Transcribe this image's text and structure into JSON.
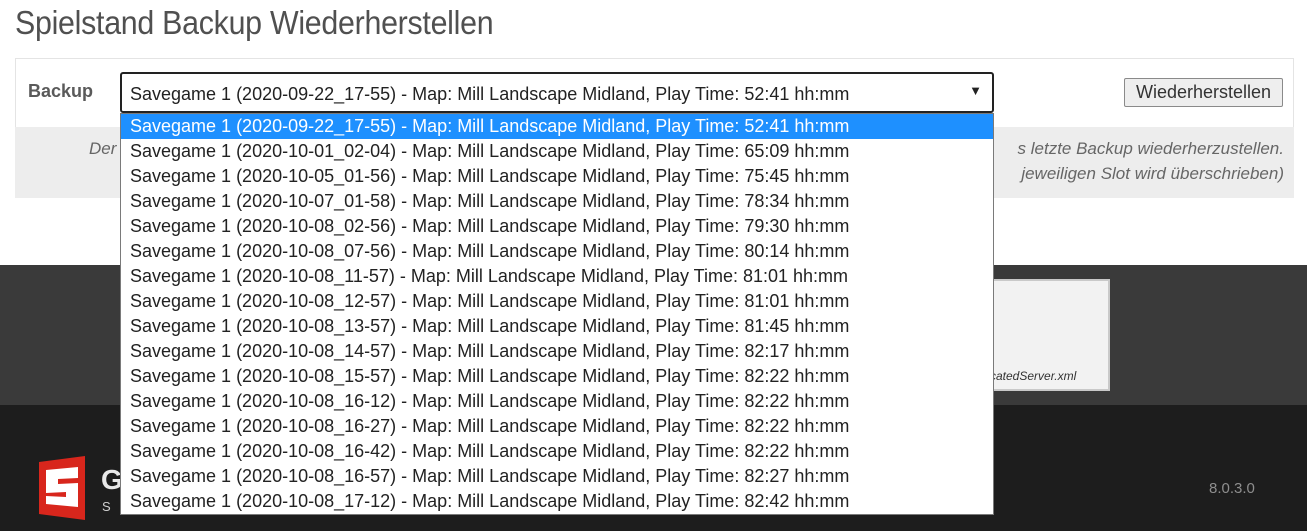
{
  "page": {
    "title": "Spielstand Backup Wiederherstellen"
  },
  "form": {
    "backup_label": "Backup",
    "selected_value": "Savegame 1 (2020-09-22_17-55) - Map: Mill Landscape Midland, Play Time: 52:41 hh:mm",
    "dropdown_arrow": "▼",
    "restore_button": "Wiederherstellen"
  },
  "info": {
    "left_fragment": "Der",
    "right_line1": "s letzte Backup wiederherzustellen.",
    "right_line2": "jeweiligen Slot wird überschrieben)"
  },
  "dropdown": {
    "options": [
      "Savegame 1 (2020-09-22_17-55) - Map: Mill Landscape Midland, Play Time: 52:41 hh:mm",
      "Savegame 1 (2020-10-01_02-04) - Map: Mill Landscape Midland, Play Time: 65:09 hh:mm",
      "Savegame 1 (2020-10-05_01-56) - Map: Mill Landscape Midland, Play Time: 75:45 hh:mm",
      "Savegame 1 (2020-10-07_01-58) - Map: Mill Landscape Midland, Play Time: 78:34 hh:mm",
      "Savegame 1 (2020-10-08_02-56) - Map: Mill Landscape Midland, Play Time: 79:30 hh:mm",
      "Savegame 1 (2020-10-08_07-56) - Map: Mill Landscape Midland, Play Time: 80:14 hh:mm",
      "Savegame 1 (2020-10-08_11-57) - Map: Mill Landscape Midland, Play Time: 81:01 hh:mm",
      "Savegame 1 (2020-10-08_12-57) - Map: Mill Landscape Midland, Play Time: 81:01 hh:mm",
      "Savegame 1 (2020-10-08_13-57) - Map: Mill Landscape Midland, Play Time: 81:45 hh:mm",
      "Savegame 1 (2020-10-08_14-57) - Map: Mill Landscape Midland, Play Time: 82:17 hh:mm",
      "Savegame 1 (2020-10-08_15-57) - Map: Mill Landscape Midland, Play Time: 82:22 hh:mm",
      "Savegame 1 (2020-10-08_16-12) - Map: Mill Landscape Midland, Play Time: 82:22 hh:mm",
      "Savegame 1 (2020-10-08_16-27) - Map: Mill Landscape Midland, Play Time: 82:22 hh:mm",
      "Savegame 1 (2020-10-08_16-42) - Map: Mill Landscape Midland, Play Time: 82:22 hh:mm",
      "Savegame 1 (2020-10-08_16-57) - Map: Mill Landscape Midland, Play Time: 82:27 hh:mm",
      "Savegame 1 (2020-10-08_17-12) - Map: Mill Landscape Midland, Play Time: 82:42 hh:mm"
    ],
    "selected_index": 0
  },
  "background": {
    "thumbnail_text": "catedServer.xml"
  },
  "footer": {
    "logo_letter": "G",
    "logo_sub": "S",
    "version": "8.0.3.0"
  },
  "colors": {
    "selected_option_bg": "#1e90ff",
    "logo_red": "#d8261c",
    "footer_top": "#3a3a3a",
    "footer_bottom": "#1d1d1d"
  }
}
